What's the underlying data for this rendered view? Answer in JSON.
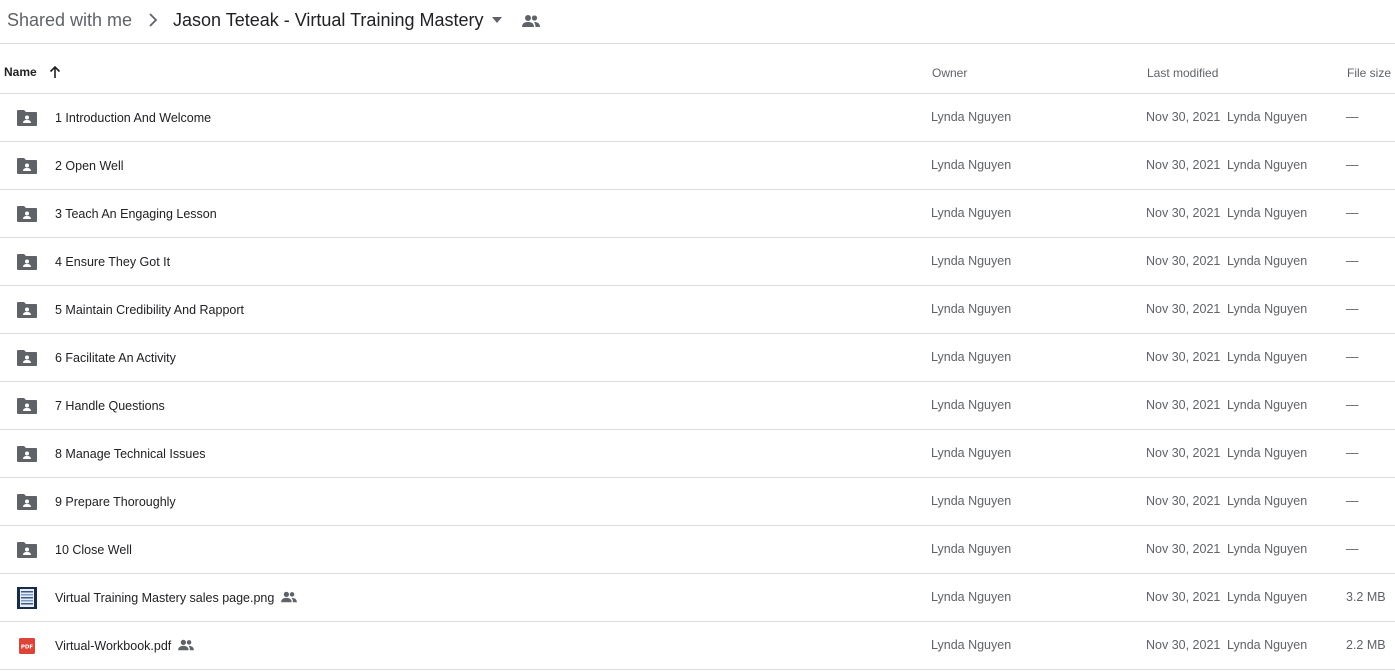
{
  "breadcrumb": {
    "root": "Shared with me",
    "current": "Jason Teteak - Virtual Training Mastery"
  },
  "columns": {
    "name": "Name",
    "owner": "Owner",
    "last_modified": "Last modified",
    "file_size": "File size"
  },
  "icons": {
    "separator": "chevron-right-icon",
    "dropdown": "caret-down-icon",
    "shared": "people-icon",
    "sort": "arrow-up-icon",
    "folder": "shared-folder-icon",
    "image": "image-thumbnail-icon",
    "pdf": "pdf-icon"
  },
  "colors": {
    "folder_icon": "#5f6368",
    "pdf_red": "#db4437",
    "divider": "#dadce0",
    "text_primary": "#202124",
    "text_secondary": "#5f6368"
  },
  "files": [
    {
      "name": "1 Introduction And Welcome",
      "type": "folder",
      "shared": false,
      "owner": "Lynda Nguyen",
      "date": "Nov 30, 2021",
      "modified_by": "Lynda Nguyen",
      "size": "—"
    },
    {
      "name": "2 Open Well",
      "type": "folder",
      "shared": false,
      "owner": "Lynda Nguyen",
      "date": "Nov 30, 2021",
      "modified_by": "Lynda Nguyen",
      "size": "—"
    },
    {
      "name": "3 Teach An Engaging Lesson",
      "type": "folder",
      "shared": false,
      "owner": "Lynda Nguyen",
      "date": "Nov 30, 2021",
      "modified_by": "Lynda Nguyen",
      "size": "—"
    },
    {
      "name": "4 Ensure They Got It",
      "type": "folder",
      "shared": false,
      "owner": "Lynda Nguyen",
      "date": "Nov 30, 2021",
      "modified_by": "Lynda Nguyen",
      "size": "—"
    },
    {
      "name": "5 Maintain Credibility And Rapport",
      "type": "folder",
      "shared": false,
      "owner": "Lynda Nguyen",
      "date": "Nov 30, 2021",
      "modified_by": "Lynda Nguyen",
      "size": "—"
    },
    {
      "name": "6 Facilitate An Activity",
      "type": "folder",
      "shared": false,
      "owner": "Lynda Nguyen",
      "date": "Nov 30, 2021",
      "modified_by": "Lynda Nguyen",
      "size": "—"
    },
    {
      "name": "7 Handle Questions",
      "type": "folder",
      "shared": false,
      "owner": "Lynda Nguyen",
      "date": "Nov 30, 2021",
      "modified_by": "Lynda Nguyen",
      "size": "—"
    },
    {
      "name": "8 Manage Technical Issues",
      "type": "folder",
      "shared": false,
      "owner": "Lynda Nguyen",
      "date": "Nov 30, 2021",
      "modified_by": "Lynda Nguyen",
      "size": "—"
    },
    {
      "name": "9 Prepare Thoroughly",
      "type": "folder",
      "shared": false,
      "owner": "Lynda Nguyen",
      "date": "Nov 30, 2021",
      "modified_by": "Lynda Nguyen",
      "size": "—"
    },
    {
      "name": "10 Close Well",
      "type": "folder",
      "shared": false,
      "owner": "Lynda Nguyen",
      "date": "Nov 30, 2021",
      "modified_by": "Lynda Nguyen",
      "size": "—"
    },
    {
      "name": "Virtual Training Mastery sales page.png",
      "type": "image",
      "shared": true,
      "owner": "Lynda Nguyen",
      "date": "Nov 30, 2021",
      "modified_by": "Lynda Nguyen",
      "size": "3.2 MB"
    },
    {
      "name": "Virtual-Workbook.pdf",
      "type": "pdf",
      "shared": true,
      "owner": "Lynda Nguyen",
      "date": "Nov 30, 2021",
      "modified_by": "Lynda Nguyen",
      "size": "2.2 MB"
    }
  ]
}
